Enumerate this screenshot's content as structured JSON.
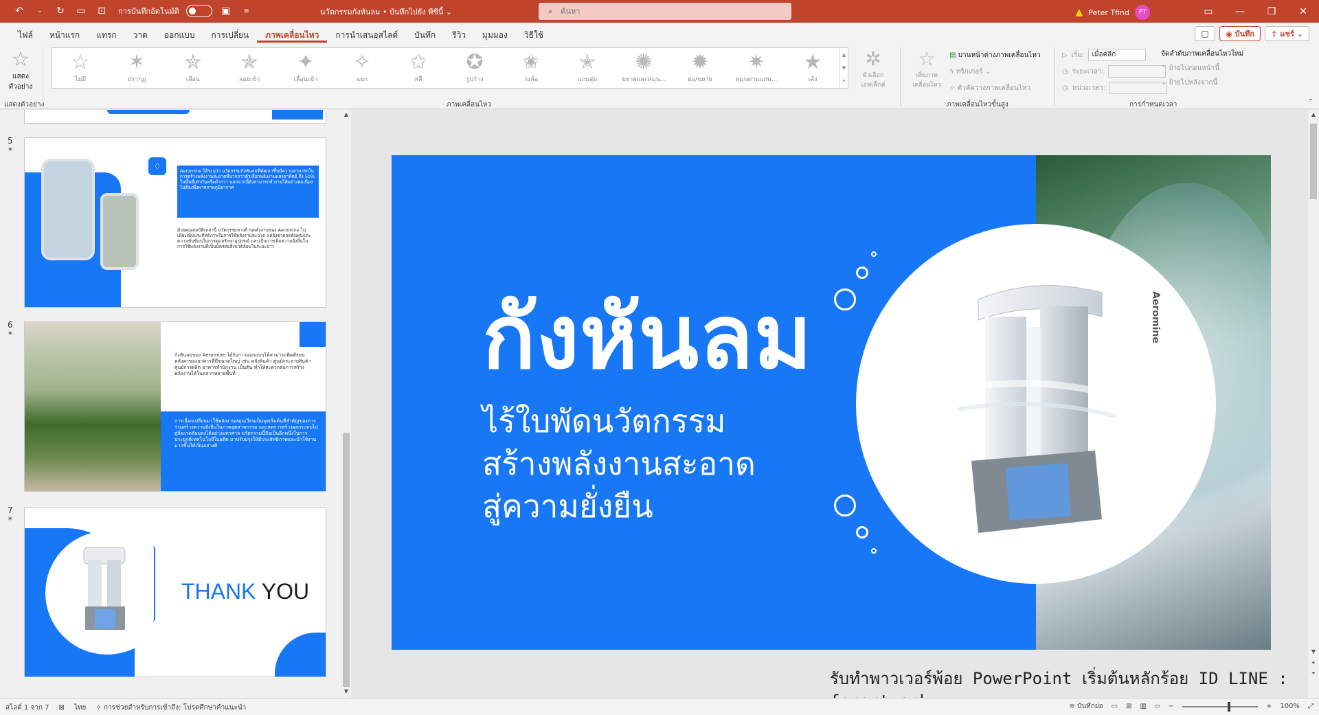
{
  "titlebar": {
    "autosave_label": "การบันทึกอัตโนมัติ",
    "doc_title": "นวัตกรรมกังหันลม • บันทึกไปยัง พีซีนี้",
    "search_placeholder": "ค้นหา",
    "user_name": "Peter Tfind",
    "user_initials": "PT",
    "accent": "#c0432c"
  },
  "tabs": [
    "ไฟล์",
    "หน้าแรก",
    "แทรก",
    "วาด",
    "ออกแบบ",
    "การเปลี่ยน",
    "ภาพเคลื่อนไหว",
    "การนำเสนอสไลด์",
    "บันทึก",
    "รีวิว",
    "มุมมอง",
    "วิธีใช้"
  ],
  "active_tab": "ภาพเคลื่อนไหว",
  "header_buttons": {
    "record": "บันทึก",
    "share": "แชร์"
  },
  "ribbon": {
    "preview_label": "แสดงตัวอย่าง",
    "preview_group": "แสดงตัวอย่าง",
    "animations": [
      "ไม่มี",
      "ปรากฏ",
      "เลือน",
      "ลอยเข้า",
      "เลื่อนเข้า",
      "แยก",
      "สลี",
      "รูปร่าง",
      "วงล้อ",
      "แถบสุ่ม",
      "ขยายและหมุน...",
      "ย่อ/ขยาย",
      "หมุนตามแกน...",
      "เด้ง"
    ],
    "animations_group": "ภาพเคลื่อนไหว",
    "effect_options": "ตัวเลือกเอฟเฟ็กต์",
    "add_animation": "เพิ่มภาพเคลื่อนไหว",
    "animation_pane": "บานหน้าต่างภาพเคลื่อนไหว",
    "trigger": "ทริกเกอร์",
    "animation_painter": "ตัวคัดวางภาพเคลื่อนไหว",
    "advanced_group": "ภาพเคลื่อนไหวขั้นสูง",
    "start_label": "เริ่ม:",
    "start_value": "เมื่อคลิก",
    "duration_label": "ระยะเวลา:",
    "delay_label": "หน่วงเวลา:",
    "reorder_title": "จัดลำดับภาพเคลื่อนไหวใหม่",
    "move_earlier": "ย้ายไปก่อนหน้านี้",
    "move_later": "ย้ายไปหลังจากนี้",
    "timing_group": "การกำหนดเวลา"
  },
  "thumbnails": {
    "slide5": {
      "num": "5",
      "box_text": "Aeromine ได้ระบุว่า นวัตกรรมกังหันลมที่พัฒนาขึ้นมีความสามารถในการสร้างพลังงานสะอาดที่มากกว่าตัวเลือกพลังงานแสงอาทิตย์ ถึง 50% ในพื้นที่เท่ากันหรือต่ำกว่า นอกจากนี้ยังสามารถทำงานได้อย่างต่อเนื่องไม่ต้องพึ่งพาสภาพภูมิอากาศ",
      "body_text": "ด้วยคุณสมบัติเหล่านี้ นวัตกรรมทางด้านพลังงานของ Aeromine ไม่เพียงเพิ่มประสิทธิภาพในการใช้พลังงานสะอาด แต่ยังช่วยลดต้นทุนและความซับซ้อนในการดูแลรักษาอุปกรณ์ และเป็นการเพิ่มความยั่งยืนในการใช้พลังงานที่เป็นมิตรต่อสิ่งแวดล้อมในระยะยาว"
    },
    "slide6": {
      "num": "6",
      "top_text": "กังหันลมของ Aeromine ได้รับการออกแบบให้สามารถติดตั้งบนหลังคาของอาคารที่มีขนาดใหญ่ เช่น คลังสินค้า ศูนย์กระจายสินค้า ศูนย์การผลิต อาคารสำนักงาน เป็นต้น ทำให้สะดวกต่อการสร้างพลังงานได้ในหลากหลายพื้นที่",
      "blue_text": "การเลือกเปลี่ยนมาใช้พลังงานหมุนเวียนเป็นจุดเริ่มต้นที่สำคัญของการร่วมสร้างความยั่งยืนในภาคอุตสาหกรรม และลดการสร้างผลกระทบไปสู่สิ่งแวดล้อมลงได้อย่างมหาศาล นวัตกรรมนี้ถือเป็นอีกหนึ่งในการประยุกต์เทคโนโลยีในอดีต มาปรับปรุงให้มีประสิทธิภาพและนำใช้งานมากขึ้นได้เป็นอย่างดี"
    },
    "slide7": {
      "num": "7",
      "thank": "THANK",
      "you": "YOU"
    }
  },
  "slide": {
    "title": "กังหันลม",
    "subtitle_lines": [
      "ไร้ใบพัดนวัตกรรม",
      "สร้างพลังงานสะอาด",
      "สู่ความยั่งยืน"
    ],
    "brand_on_device": "Aeromine",
    "footer": "รับทำพาวเวอร์พ้อย PowerPoint เริ่มต้นหลักร้อย ID LINE : forartwork",
    "blue": "#1777f5"
  },
  "status": {
    "slide_counter": "สไลด์ 1 จาก 7",
    "language": "ไทย",
    "accessibility": "การช่วยสำหรับการเข้าถึง: โปรดศึกษาคำแนะนำ",
    "notes": "บันทึกย่อ",
    "zoom": "100%"
  }
}
